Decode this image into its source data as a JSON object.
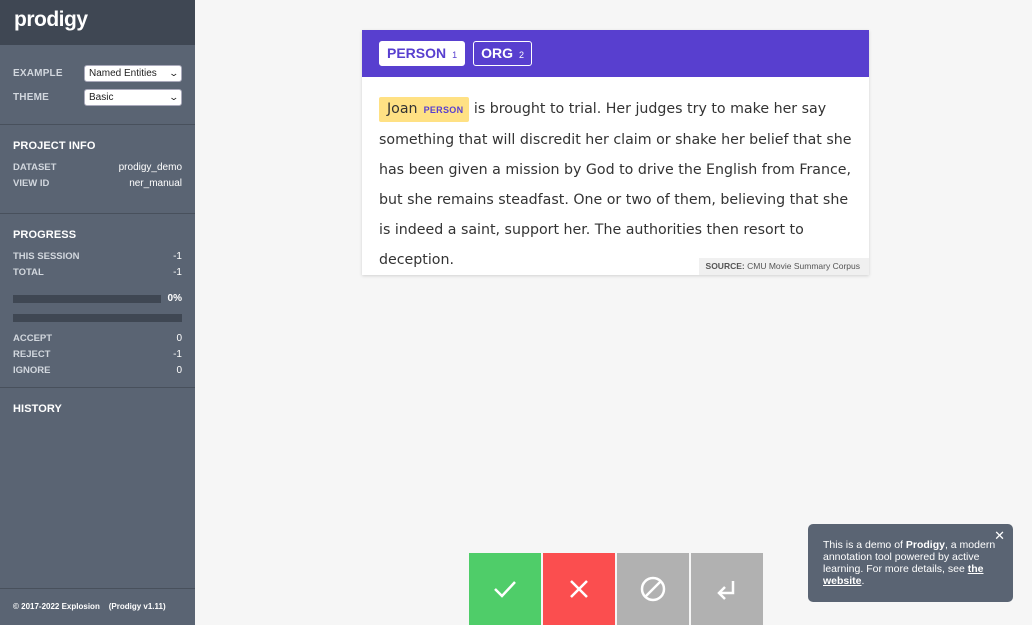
{
  "sidebar": {
    "logo": "prodigy",
    "settings": {
      "example_label": "EXAMPLE",
      "example_value": "Named Entities",
      "theme_label": "THEME",
      "theme_value": "Basic"
    },
    "project_info": {
      "title": "PROJECT INFO",
      "dataset_label": "DATASET",
      "dataset_value": "prodigy_demo",
      "view_id_label": "VIEW ID",
      "view_id_value": "ner_manual"
    },
    "progress": {
      "title": "PROGRESS",
      "this_session_label": "THIS SESSION",
      "this_session_value": "-1",
      "total_label": "TOTAL",
      "total_value": "-1",
      "percent": "0%",
      "progress_fraction": 0,
      "accept_label": "ACCEPT",
      "accept_value": "0",
      "reject_label": "REJECT",
      "reject_value": "-1",
      "ignore_label": "IGNORE",
      "ignore_value": "0"
    },
    "history": {
      "title": "HISTORY"
    },
    "footer": "© 2017-2022 Explosion    (Prodigy v1.11)"
  },
  "card": {
    "labels": [
      {
        "name": "PERSON",
        "key": "1"
      },
      {
        "name": "ORG",
        "key": "2"
      }
    ],
    "entity_text": "Joan",
    "entity_label": "PERSON",
    "text_rest": " is brought to trial. Her judges try to make her say something that will discredit her claim or shake her belief that she has been given a mission by God to drive the English from France, but she remains steadfast. One or two of them, believing that she is indeed a saint, support her. The authorities then resort to deception.",
    "source_label": "SOURCE:",
    "source_value": "CMU Movie Summary Corpus"
  },
  "actions": {
    "accept_icon": "check-icon",
    "reject_icon": "x-icon",
    "ignore_icon": "no-entry-icon",
    "undo_icon": "return-arrow-icon"
  },
  "toast": {
    "text_before": "This is a demo of ",
    "bold": "Prodigy",
    "text_middle": ", a modern annotation tool powered by active learning. For more details, see ",
    "link": "the website",
    "text_after": "."
  },
  "colors": {
    "accent": "#583fcf",
    "entity_highlight": "#ffe184",
    "accept": "#4fcd69",
    "reject": "#fb4e4f",
    "ignore": "#b1b1b1",
    "sidebar": "#5a6473"
  }
}
